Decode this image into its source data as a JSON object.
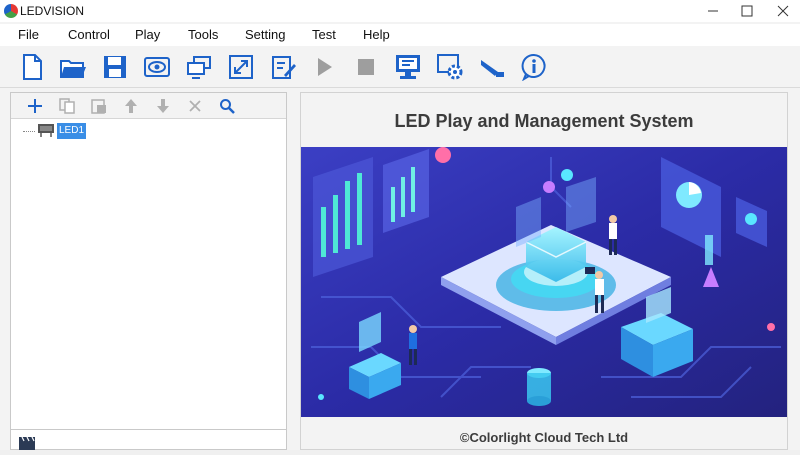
{
  "window": {
    "title": "LEDVISION"
  },
  "menu": {
    "items": [
      "File",
      "Control",
      "Play",
      "Tools",
      "Setting",
      "Test",
      "Help"
    ]
  },
  "toolbar": {
    "icons": [
      "new-file-icon",
      "open-folder-icon",
      "save-icon",
      "preview-eye-icon",
      "display-screens-icon",
      "fullscreen-icon",
      "edit-icon",
      "play-icon",
      "stop-icon",
      "monitor-icon",
      "settings-gear-icon",
      "test-tool-icon",
      "info-icon"
    ]
  },
  "left_panel": {
    "toolbar_icons": [
      "add-icon",
      "copy-icon",
      "paste-icon",
      "move-up-icon",
      "move-down-icon",
      "delete-icon",
      "search-icon"
    ],
    "tree": [
      {
        "label": "LED1",
        "selected": true
      }
    ],
    "footer_icon": "clapperboard-icon"
  },
  "right_panel": {
    "title": "LED Play and Management System",
    "copyright": "©Colorlight Cloud Tech Ltd"
  },
  "colors": {
    "accent": "#1e63c9",
    "selection": "#3a8ee6",
    "hero_bg": "#2e2b9e",
    "teal": "#39e0e8"
  }
}
